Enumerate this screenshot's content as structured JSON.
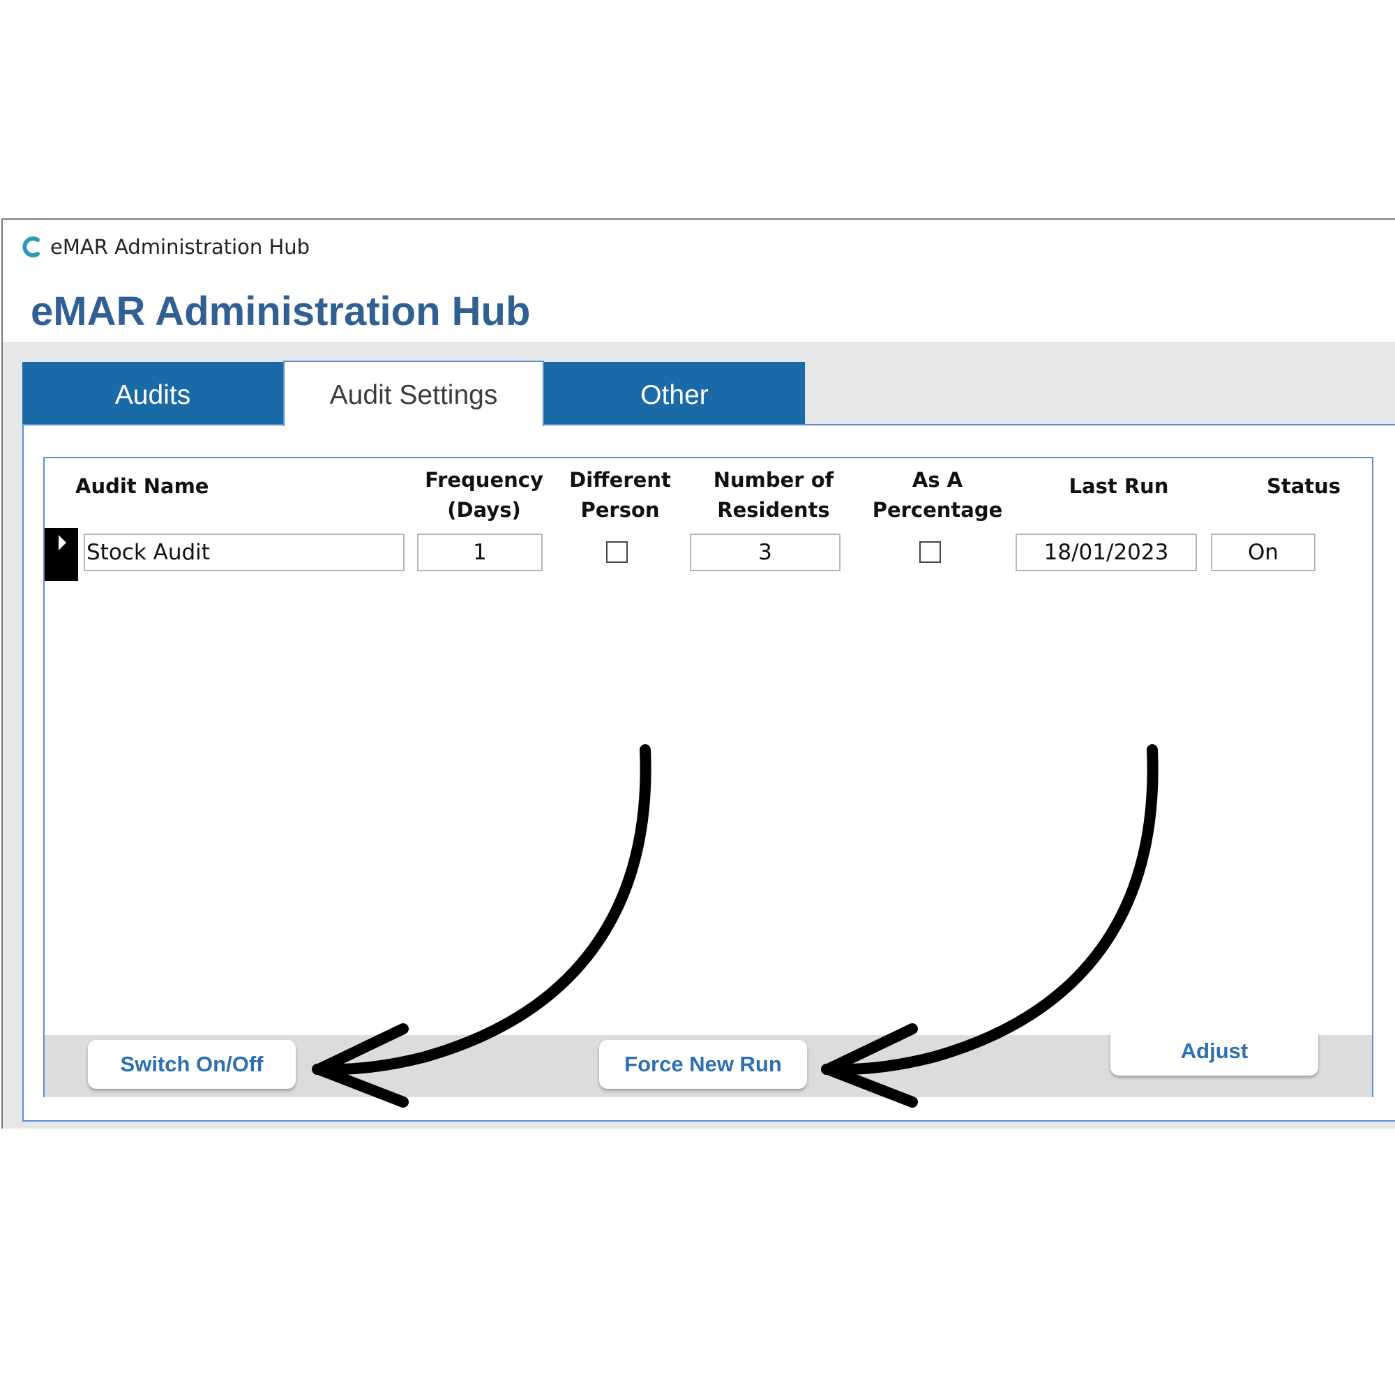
{
  "window": {
    "title": "eMAR Administration Hub",
    "icon": "app-logo-c-icon",
    "accent": "#1b6aa8"
  },
  "header": {
    "title": "eMAR Administration Hub"
  },
  "tabs": [
    {
      "label": "Audits",
      "active": false
    },
    {
      "label": "Audit Settings",
      "active": true
    },
    {
      "label": "Other",
      "active": false
    }
  ],
  "table": {
    "columns": {
      "audit_name": "Audit Name",
      "frequency_line1": "Frequency",
      "frequency_line2": "(Days)",
      "different_line1": "Different",
      "different_line2": "Person",
      "residents_line1": "Number of",
      "residents_line2": "Residents",
      "percentage_line1": "As A",
      "percentage_line2": "Percentage",
      "last_run": "Last Run",
      "status": "Status"
    },
    "rows": [
      {
        "audit_name": "Stock Audit",
        "frequency": "1",
        "different_person": false,
        "residents": "3",
        "as_percentage": false,
        "last_run": "18/01/2023",
        "status": "On"
      }
    ]
  },
  "buttons": {
    "switch": "Switch On/Off",
    "force": "Force New Run",
    "adjust": "Adjust"
  },
  "annotations": {
    "arrow_color": "#000000"
  }
}
